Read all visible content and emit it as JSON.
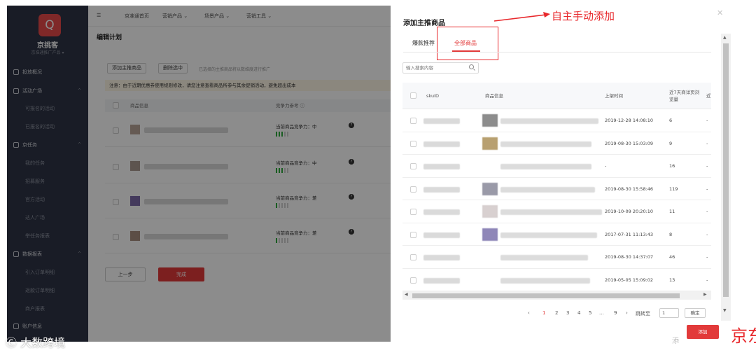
{
  "sidebar": {
    "logo": "Q",
    "brand": "京挑客",
    "brand_sub": "京准通推广产品 ▾",
    "items": [
      {
        "label": "投放概况",
        "type": "group"
      },
      {
        "label": "活动广场",
        "type": "group",
        "caret": "^"
      },
      {
        "label": "可报名的活动",
        "type": "sub"
      },
      {
        "label": "已报名的活动",
        "type": "sub"
      },
      {
        "label": "京任务",
        "type": "group",
        "caret": "^"
      },
      {
        "label": "我的任务",
        "type": "sub"
      },
      {
        "label": "招募服务",
        "type": "sub"
      },
      {
        "label": "官方活动",
        "type": "sub"
      },
      {
        "label": "达人广场",
        "type": "sub"
      },
      {
        "label": "举任务报表",
        "type": "sub"
      },
      {
        "label": "数据报表",
        "type": "group",
        "caret": "^"
      },
      {
        "label": "引入订单明细",
        "type": "sub"
      },
      {
        "label": "返款订单明细",
        "type": "sub"
      },
      {
        "label": "商户报表",
        "type": "sub"
      },
      {
        "label": "账户信息",
        "type": "group"
      }
    ]
  },
  "topbar": {
    "menu_icon": "hamburger-icon",
    "items": [
      "京准通首页",
      "营销产品 ⌄",
      "场景产品 ⌄",
      "营销工具 ⌄"
    ]
  },
  "page": {
    "title": "编辑计划",
    "add_main_btn": "添加主推商品",
    "delete_selected_btn": "删除选中",
    "selection_hint": "已选择的主推商品将以数维度进行推广",
    "notice": "注意：由于近期优惠券使用规则修改，请您注意查看商品所参与其余促销活动，避免超出成本",
    "col_product": "商品信息",
    "col_competition": "竞争力参考 ⓘ",
    "rows": [
      {
        "level": "中",
        "bars_on": 3
      },
      {
        "level": "中",
        "bars_on": 3
      },
      {
        "level": "差",
        "bars_on": 1
      },
      {
        "level": "差",
        "bars_on": 1
      }
    ],
    "competition_prefix": "当前商品竞争力：",
    "prev_btn": "上一步",
    "done_btn": "完成"
  },
  "drawer": {
    "title": "添加主推商品",
    "close_icon": "close-icon",
    "annotation_text": "自主手动添加",
    "tabs": [
      {
        "label": "爆款推荐",
        "active": false
      },
      {
        "label": "全部商品",
        "active": true
      }
    ],
    "search_placeholder": "输入搜索内容",
    "columns": {
      "sku": "skuID",
      "product": "商品信息",
      "time": "上架时间",
      "views": "近7天商详页浏览量",
      "extra": "近"
    },
    "rows": [
      {
        "time": "2019-12-28 14:08:10",
        "views": "6",
        "extra": "-",
        "thumb": "#8d8d8d",
        "blur_w": 140
      },
      {
        "time": "2019-08-30 15:03:09",
        "views": "9",
        "extra": "-",
        "thumb": "#b8a071",
        "blur_w": 130
      },
      {
        "time": "-",
        "views": "16",
        "extra": "-",
        "thumb": "",
        "blur_w": 130
      },
      {
        "time": "2019-08-30 15:58:46",
        "views": "119",
        "extra": "-",
        "thumb": "#9a9aa8",
        "blur_w": 135
      },
      {
        "time": "2019-10-09 20:20:10",
        "views": "11",
        "extra": "-",
        "thumb": "#d8d0d0",
        "blur_w": 145
      },
      {
        "time": "2017-07-31 11:13:43",
        "views": "8",
        "extra": "-",
        "thumb": "#8f87b8",
        "blur_w": 138
      },
      {
        "time": "2019-08-30 14:37:07",
        "views": "46",
        "extra": "-",
        "thumb": "",
        "blur_w": 125
      },
      {
        "time": "2019-05-05 15:09:02",
        "views": "13",
        "extra": "-",
        "thumb": "",
        "blur_w": 128
      }
    ],
    "pager": {
      "prev": "‹",
      "pages": [
        "1",
        "2",
        "3",
        "4",
        "5",
        "...",
        "9"
      ],
      "active": "1",
      "next": "›",
      "jump_label": "跳转至",
      "jump_value": "1",
      "jump_btn": "确定"
    },
    "add_btn": "添加"
  },
  "watermarks": {
    "left": "Ⓒ 大数跨境",
    "right": "京东",
    "right_small": "添"
  },
  "colors": {
    "accent": "#e23a3a",
    "annotation": "#e8282c",
    "sidebar_bg": "#2e3445",
    "bar_green": "#2faa3c"
  }
}
